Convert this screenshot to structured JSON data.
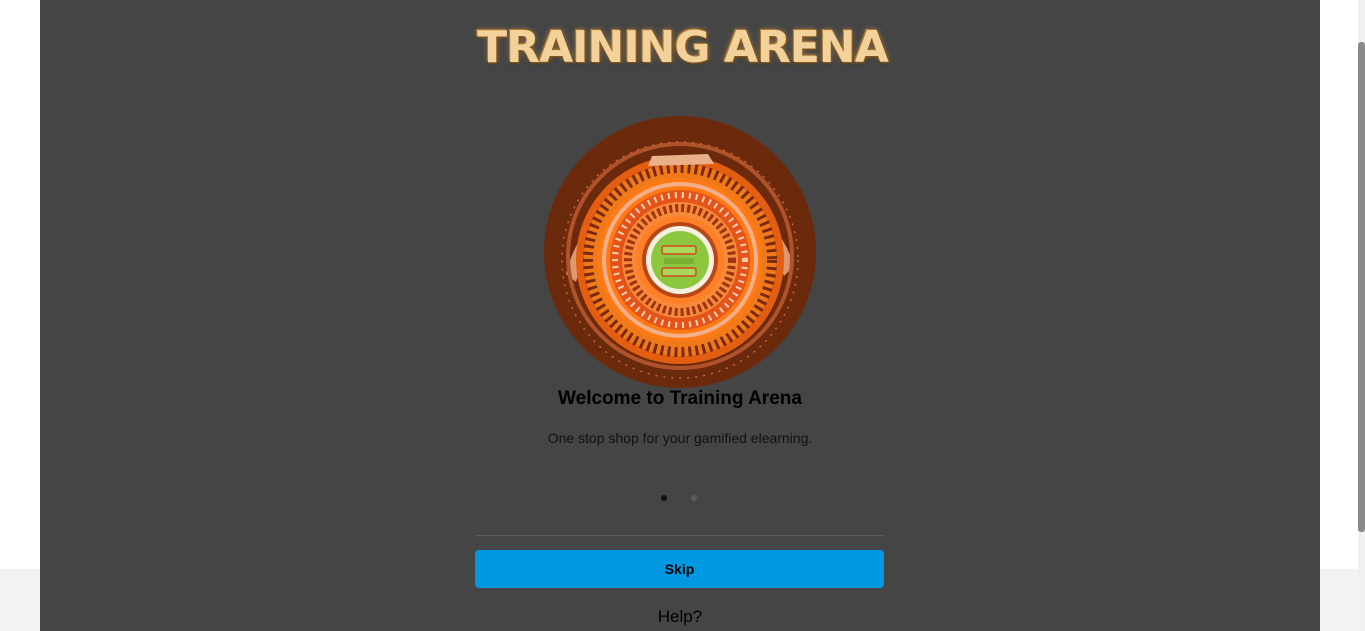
{
  "logo": {
    "text": "TRAINING ARENA"
  },
  "hero": {
    "image_name": "arena-illustration"
  },
  "welcome": {
    "title": "Welcome to Training Arena",
    "subtitle": "One stop shop for your gamified elearning."
  },
  "carousel": {
    "slide_count": 2,
    "active_index": 0
  },
  "actions": {
    "skip_label": "Skip",
    "help_label": "Help?"
  },
  "colors": {
    "overlay": "#454545",
    "skip_button": "#0098e0",
    "arena_outer": "#6b2a0c",
    "arena_orange": "#f07010",
    "arena_center": "#8dc63f"
  }
}
